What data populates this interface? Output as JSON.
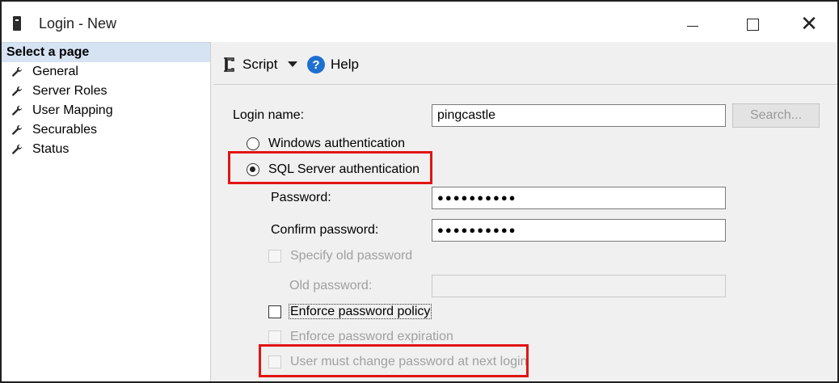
{
  "window": {
    "title": "Login - New",
    "minimize_icon": "minimize-icon",
    "maximize_icon": "maximize-icon",
    "close_icon": "close-icon"
  },
  "sidebar": {
    "header": "Select a page",
    "item_icon": "wrench-icon",
    "items": [
      {
        "label": "General"
      },
      {
        "label": "Server Roles"
      },
      {
        "label": "User Mapping"
      },
      {
        "label": "Securables"
      },
      {
        "label": "Status"
      }
    ]
  },
  "toolbar": {
    "script_label": "Script",
    "help_label": "Help",
    "help_glyph": "?"
  },
  "form": {
    "login_name_label": "Login name:",
    "login_name_value": "pingcastle",
    "search_label": "Search...",
    "windows_auth_label": "Windows authentication",
    "sql_auth_label": "SQL Server authentication",
    "sql_auth_selected": true,
    "password_label": "Password:",
    "password_value": "●●●●●●●●●●",
    "confirm_password_label": "Confirm password:",
    "confirm_password_value": "●●●●●●●●●●",
    "specify_old_password_label": "Specify old password",
    "old_password_label": "Old password:",
    "enforce_policy_label": "Enforce password policy",
    "enforce_expiration_label": "Enforce password expiration",
    "must_change_label": "User must change password at next login"
  },
  "colors": {
    "highlight_red": "#e21414",
    "sidebar_header_bg": "#d6e3f2",
    "help_blue": "#1f6fd1"
  }
}
